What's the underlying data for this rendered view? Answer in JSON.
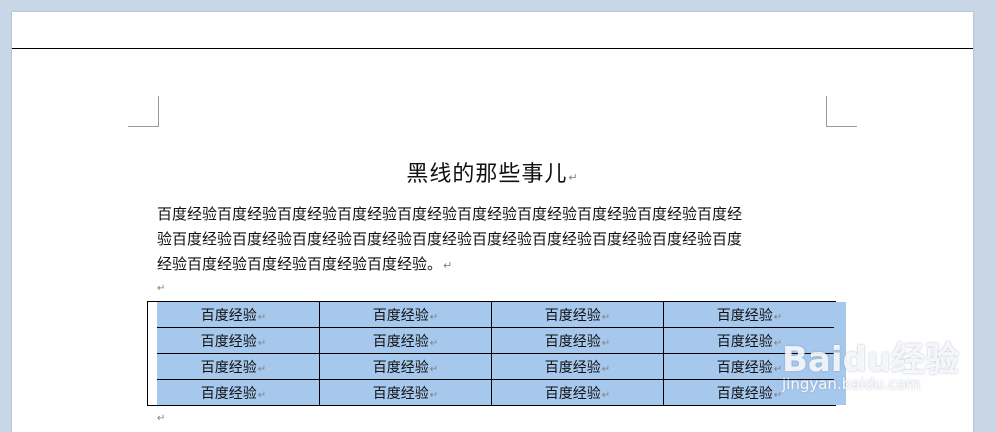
{
  "document": {
    "title": "黑线的那些事儿",
    "paragraph_lines": [
      "百度经验百度经验百度经验百度经验百度经验百度经验百度经验百度经验百度经验百度经",
      "验百度经验百度经验百度经验百度经验百度经验百度经验百度经验百度经验百度经验百度",
      "经验百度经验百度经验百度经验百度经验。"
    ],
    "paragraph_mark": "↵"
  },
  "table": {
    "rows": [
      [
        "百度经验",
        "百度经验",
        "百度经验",
        "百度经验"
      ],
      [
        "百度经验",
        "百度经验",
        "百度经验",
        "百度经验"
      ],
      [
        "百度经验",
        "百度经验",
        "百度经验",
        "百度经验"
      ],
      [
        "百度经验",
        "百度经验",
        "百度经验",
        "百度经验"
      ]
    ],
    "selection_color": "#a7c8ed"
  },
  "watermark": {
    "logo": "Baidu经验",
    "url": "jingyan.baidu.com"
  }
}
